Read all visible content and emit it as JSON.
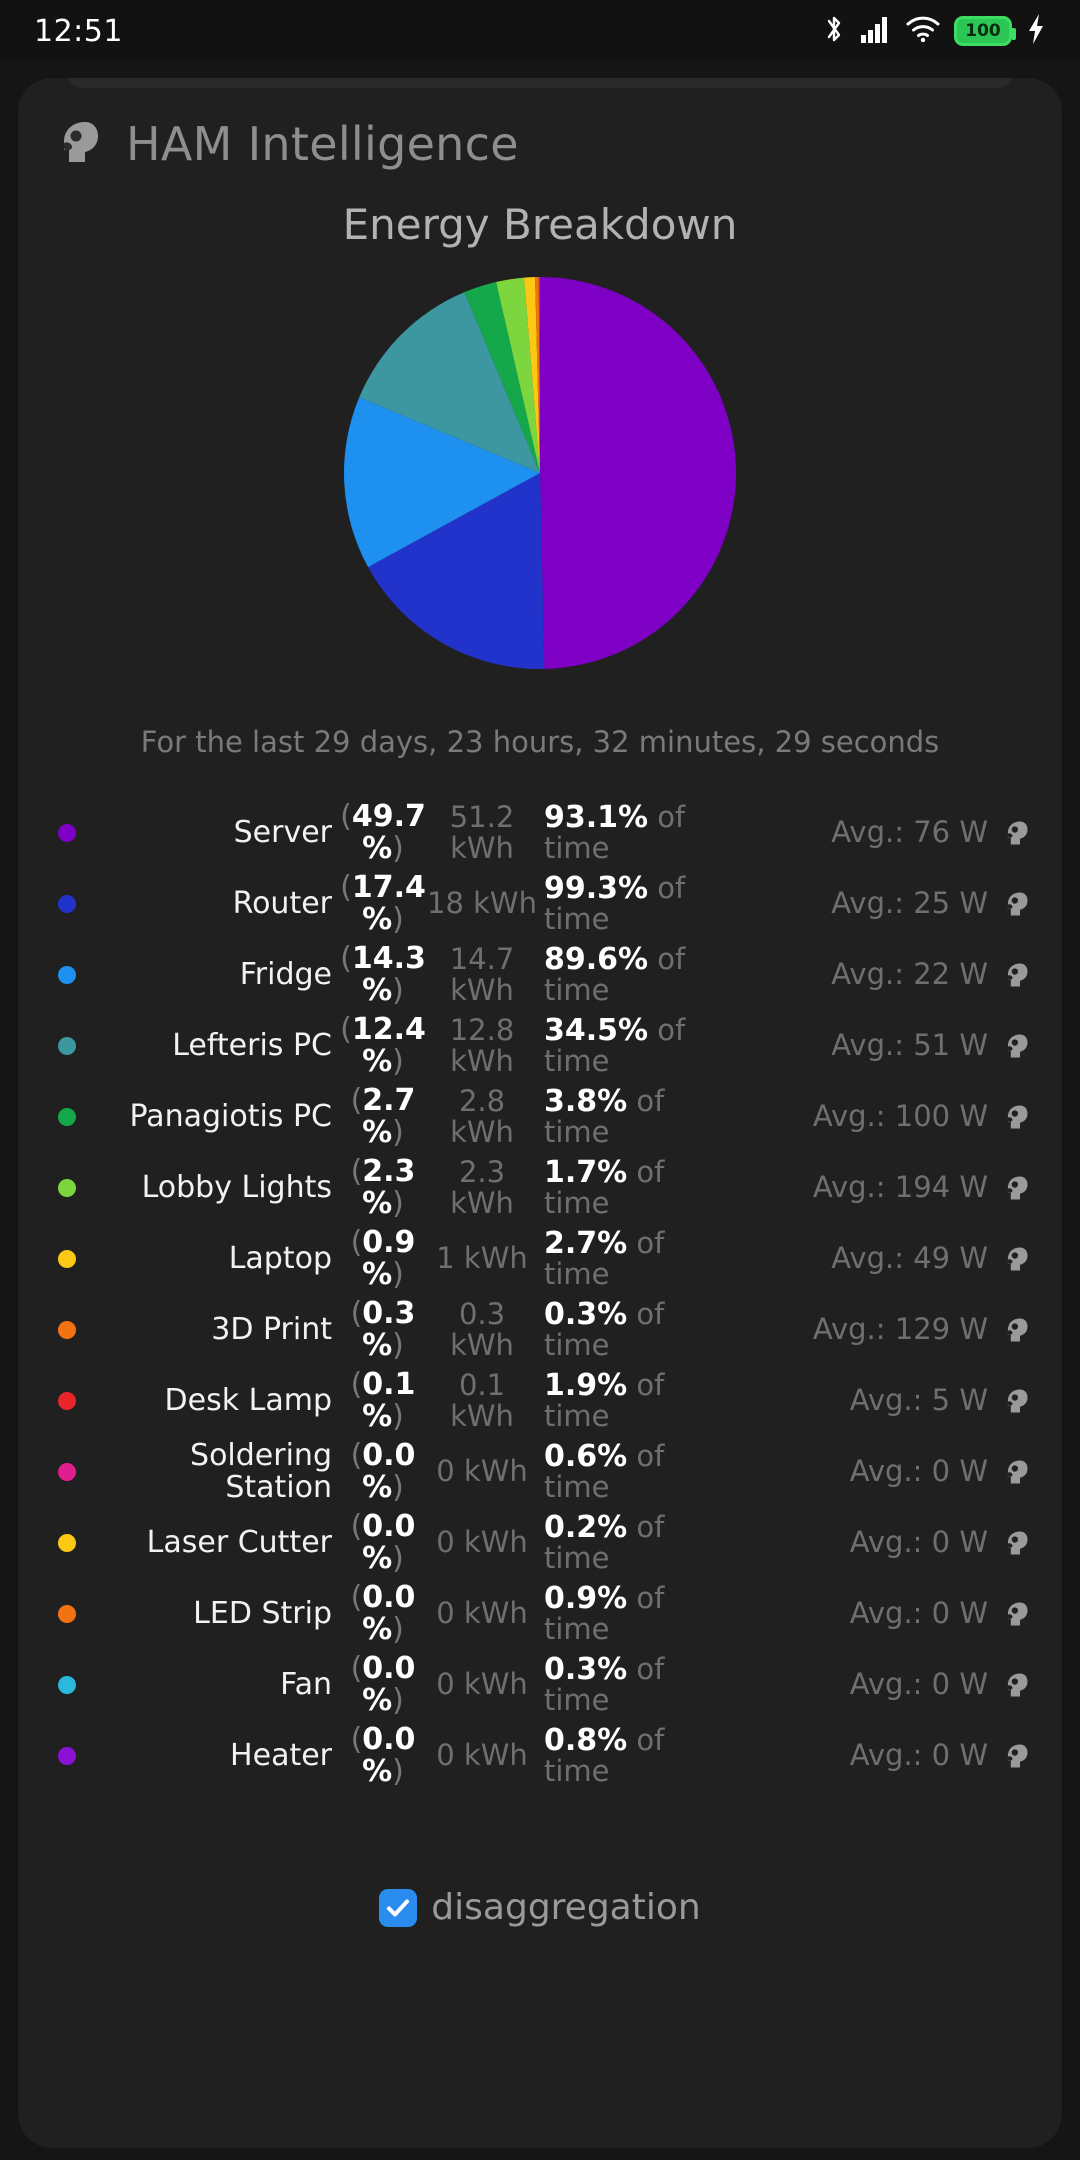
{
  "status_bar": {
    "time": "12:51",
    "battery_level": "100",
    "icons": [
      "bluetooth-icon",
      "cellular-signal-icon",
      "wifi-icon",
      "battery-icon",
      "charging-bolt-icon"
    ],
    "battery_color": "#2bc653"
  },
  "app": {
    "title": "HAM Intelligence",
    "icon": "head-profile-icon"
  },
  "chart": {
    "title": "Energy Breakdown",
    "range_text": "For the last 29 days, 23 hours, 32 minutes, 29 seconds"
  },
  "chart_data": {
    "type": "pie",
    "title": "Energy Breakdown",
    "categories": [
      "Server",
      "Router",
      "Fridge",
      "Lefteris PC",
      "Panagiotis PC",
      "Lobby Lights",
      "Laptop",
      "3D Print",
      "Desk Lamp",
      "Soldering Station",
      "Laser Cutter",
      "LED Strip",
      "Fan",
      "Heater"
    ],
    "values": [
      49.7,
      17.4,
      14.3,
      12.4,
      2.7,
      2.3,
      0.9,
      0.3,
      0.1,
      0.0,
      0.0,
      0.0,
      0.0,
      0.0
    ],
    "unit": "%",
    "energy_kwh": [
      51.2,
      18,
      14.7,
      12.8,
      2.8,
      2.3,
      1,
      0.3,
      0.1,
      0,
      0,
      0,
      0,
      0
    ],
    "percent_of_time": [
      93.1,
      99.3,
      89.6,
      34.5,
      3.8,
      1.7,
      2.7,
      0.3,
      1.9,
      0.6,
      0.2,
      0.9,
      0.3,
      0.8
    ],
    "avg_watts": [
      76,
      25,
      22,
      51,
      100,
      194,
      49,
      129,
      5,
      0,
      0,
      0,
      0,
      0
    ],
    "colors": [
      "#7d00c4",
      "#2233cc",
      "#1e90ef",
      "#3c97a0",
      "#15a84a",
      "#7ed63f",
      "#fbc913",
      "#f37312",
      "#e8252b",
      "#e01d8d",
      "#fbc913",
      "#f37312",
      "#2bb8dd",
      "#8b12d4"
    ],
    "legend_position": "below",
    "start_angle": 0,
    "direction": "clockwise"
  },
  "legend": {
    "rows": [
      {
        "name": "Server",
        "pct": "49.7 %",
        "kwh": "51.2 kWh",
        "time": "93.1%",
        "time_suffix": "of time",
        "avg": "Avg.: 76 W",
        "color": "#7d00c4"
      },
      {
        "name": "Router",
        "pct": "17.4 %",
        "kwh": "18 kWh",
        "time": "99.3%",
        "time_suffix": "of time",
        "avg": "Avg.: 25 W",
        "color": "#2233cc"
      },
      {
        "name": "Fridge",
        "pct": "14.3 %",
        "kwh": "14.7 kWh",
        "time": "89.6%",
        "time_suffix": "of time",
        "avg": "Avg.: 22 W",
        "color": "#1e90ef"
      },
      {
        "name": "Lefteris PC",
        "pct": "12.4 %",
        "kwh": "12.8 kWh",
        "time": "34.5%",
        "time_suffix": "of time",
        "avg": "Avg.: 51 W",
        "color": "#3c97a0"
      },
      {
        "name": "Panagiotis PC",
        "pct": "2.7 %",
        "kwh": "2.8 kWh",
        "time": "3.8%",
        "time_suffix": "of time",
        "avg": "Avg.: 100 W",
        "color": "#15a84a"
      },
      {
        "name": "Lobby Lights",
        "pct": "2.3 %",
        "kwh": "2.3 kWh",
        "time": "1.7%",
        "time_suffix": "of time",
        "avg": "Avg.: 194 W",
        "color": "#7ed63f"
      },
      {
        "name": "Laptop",
        "pct": "0.9 %",
        "kwh": "1 kWh",
        "time": "2.7%",
        "time_suffix": "of time",
        "avg": "Avg.: 49 W",
        "color": "#fbc913"
      },
      {
        "name": "3D Print",
        "pct": "0.3 %",
        "kwh": "0.3 kWh",
        "time": "0.3%",
        "time_suffix": "of time",
        "avg": "Avg.: 129 W",
        "color": "#f37312"
      },
      {
        "name": "Desk Lamp",
        "pct": "0.1 %",
        "kwh": "0.1 kWh",
        "time": "1.9%",
        "time_suffix": "of time",
        "avg": "Avg.: 5 W",
        "color": "#e8252b"
      },
      {
        "name": "Soldering Station",
        "pct": "0.0 %",
        "kwh": "0 kWh",
        "time": "0.6%",
        "time_suffix": "of time",
        "avg": "Avg.: 0 W",
        "color": "#e01d8d"
      },
      {
        "name": "Laser Cutter",
        "pct": "0.0 %",
        "kwh": "0 kWh",
        "time": "0.2%",
        "time_suffix": "of time",
        "avg": "Avg.: 0 W",
        "color": "#fbc913"
      },
      {
        "name": "LED Strip",
        "pct": "0.0 %",
        "kwh": "0 kWh",
        "time": "0.9%",
        "time_suffix": "of time",
        "avg": "Avg.: 0 W",
        "color": "#f37312"
      },
      {
        "name": "Fan",
        "pct": "0.0 %",
        "kwh": "0 kWh",
        "time": "0.3%",
        "time_suffix": "of time",
        "avg": "Avg.: 0 W",
        "color": "#2bb8dd"
      },
      {
        "name": "Heater",
        "pct": "0.0 %",
        "kwh": "0 kWh",
        "time": "0.8%",
        "time_suffix": "of time",
        "avg": "Avg.: 0 W",
        "color": "#8b12d4"
      }
    ]
  },
  "footer": {
    "checkbox_label": "disaggregation",
    "checkbox_checked": true,
    "checkbox_color": "#2b8cf0"
  }
}
